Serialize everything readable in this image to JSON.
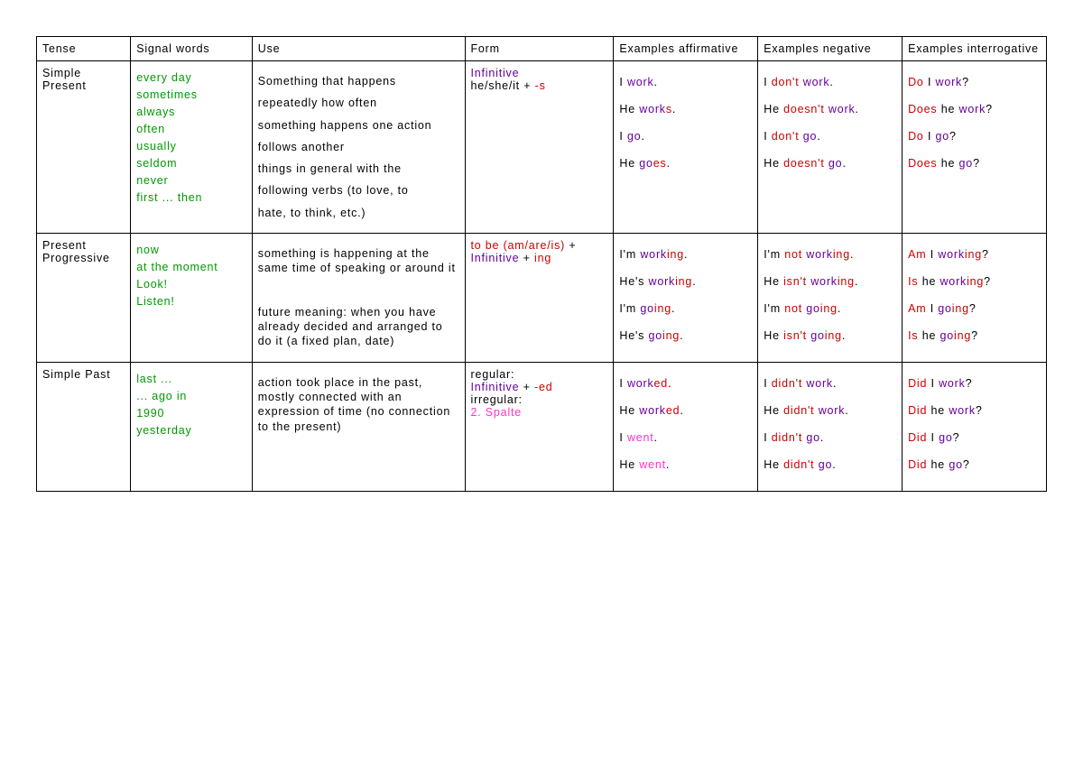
{
  "headers": {
    "tense": "Tense",
    "signal": "Signal words",
    "use": "Use",
    "form": "Form",
    "ex_aff": "Examples affirmative",
    "ex_neg": "Examples negative",
    "ex_int": "Examples interrogative"
  },
  "rows": [
    {
      "tense": "Simple Present",
      "signals": [
        "every day",
        "sometimes",
        "always",
        "often",
        "usually",
        "seldom",
        "never",
        "first ... then"
      ],
      "use_lines": [
        "Something that happens",
        "repeatedly how often",
        "something happens one action",
        "follows another",
        "things in general with the",
        "following verbs (to love, to",
        "hate, to think, etc.)"
      ],
      "form_segments": [
        {
          "text": "Infinitive",
          "cls": "purple"
        },
        {
          "text": "",
          "cls": ""
        },
        {
          "text": "he/she/it + ",
          "cls": ""
        },
        {
          "text": "-s",
          "cls": "red",
          "inline_after_prev": true
        }
      ],
      "ex_aff": [
        [
          {
            "t": "I ",
            "c": ""
          },
          {
            "t": "work",
            "c": "purple"
          },
          {
            "t": ".",
            "c": ""
          }
        ],
        [
          {
            "t": "He ",
            "c": ""
          },
          {
            "t": "work",
            "c": "purple"
          },
          {
            "t": "s",
            "c": "red"
          },
          {
            "t": ".",
            "c": ""
          }
        ],
        [
          {
            "t": "I ",
            "c": ""
          },
          {
            "t": "go",
            "c": "purple"
          },
          {
            "t": ".",
            "c": ""
          }
        ],
        [
          {
            "t": "He ",
            "c": ""
          },
          {
            "t": "go",
            "c": "purple"
          },
          {
            "t": "es",
            "c": "red"
          },
          {
            "t": ".",
            "c": ""
          }
        ]
      ],
      "ex_neg": [
        [
          {
            "t": "I ",
            "c": ""
          },
          {
            "t": "don't",
            "c": "red"
          },
          {
            "t": " ",
            "c": ""
          },
          {
            "t": "work",
            "c": "purple"
          },
          {
            "t": ".",
            "c": ""
          }
        ],
        [
          {
            "t": "He ",
            "c": ""
          },
          {
            "t": "doesn't",
            "c": "red"
          },
          {
            "t": " ",
            "c": ""
          },
          {
            "t": "work",
            "c": "purple"
          },
          {
            "t": ".",
            "c": ""
          }
        ],
        [
          {
            "t": "I ",
            "c": ""
          },
          {
            "t": "don't",
            "c": "red"
          },
          {
            "t": " ",
            "c": ""
          },
          {
            "t": "go",
            "c": "purple"
          },
          {
            "t": ".",
            "c": ""
          }
        ],
        [
          {
            "t": "He ",
            "c": ""
          },
          {
            "t": "doesn't",
            "c": "red"
          },
          {
            "t": " ",
            "c": ""
          },
          {
            "t": "go",
            "c": "purple"
          },
          {
            "t": ".",
            "c": ""
          }
        ]
      ],
      "ex_int": [
        [
          {
            "t": "Do",
            "c": "red"
          },
          {
            "t": " I ",
            "c": ""
          },
          {
            "t": "work",
            "c": "purple"
          },
          {
            "t": "?",
            "c": ""
          }
        ],
        [
          {
            "t": "Does",
            "c": "red"
          },
          {
            "t": " he ",
            "c": ""
          },
          {
            "t": "work",
            "c": "purple"
          },
          {
            "t": "?",
            "c": ""
          }
        ],
        [
          {
            "t": "Do",
            "c": "red"
          },
          {
            "t": " I ",
            "c": ""
          },
          {
            "t": "go",
            "c": "purple"
          },
          {
            "t": "?",
            "c": ""
          }
        ],
        [
          {
            "t": "Does",
            "c": "red"
          },
          {
            "t": " he ",
            "c": ""
          },
          {
            "t": "go",
            "c": "purple"
          },
          {
            "t": "?",
            "c": ""
          }
        ]
      ]
    },
    {
      "tense": "Present Progressive",
      "signals": [
        "now",
        "at the moment",
        "Look!",
        "Listen!"
      ],
      "use_lines": [
        "something is happening at the same time of speaking or around it",
        "",
        "future meaning: when you have already decided and arranged to do it (a fixed plan, date)"
      ],
      "form_segments": [
        {
          "text": "to be (am/are/is)",
          "cls": "red"
        },
        {
          "text": " + ",
          "cls": "",
          "inline_after_prev": true
        },
        {
          "text": "Infinitive",
          "cls": "purple"
        },
        {
          "text": " + ",
          "cls": "",
          "inline_after_prev": true
        },
        {
          "text": "ing",
          "cls": "red",
          "inline_after_prev": true
        }
      ],
      "ex_aff": [
        [
          {
            "t": "I'm ",
            "c": ""
          },
          {
            "t": "work",
            "c": "purple"
          },
          {
            "t": "ing",
            "c": "red"
          },
          {
            "t": ".",
            "c": ""
          }
        ],
        [
          {
            "t": "He's ",
            "c": ""
          },
          {
            "t": "work",
            "c": "purple"
          },
          {
            "t": "ing",
            "c": "red"
          },
          {
            "t": ".",
            "c": ""
          }
        ],
        [
          {
            "t": "I'm ",
            "c": ""
          },
          {
            "t": "go",
            "c": "purple"
          },
          {
            "t": "ing",
            "c": "red"
          },
          {
            "t": ".",
            "c": ""
          }
        ],
        [
          {
            "t": "He's ",
            "c": ""
          },
          {
            "t": "go",
            "c": "purple"
          },
          {
            "t": "ing",
            "c": "red"
          },
          {
            "t": ".",
            "c": ""
          }
        ]
      ],
      "ex_neg": [
        [
          {
            "t": "I'm ",
            "c": ""
          },
          {
            "t": "not",
            "c": "red"
          },
          {
            "t": " ",
            "c": ""
          },
          {
            "t": "work",
            "c": "purple"
          },
          {
            "t": "ing",
            "c": "red"
          },
          {
            "t": ".",
            "c": ""
          }
        ],
        [
          {
            "t": "He ",
            "c": ""
          },
          {
            "t": "isn't",
            "c": "red"
          },
          {
            "t": " ",
            "c": ""
          },
          {
            "t": "work",
            "c": "purple"
          },
          {
            "t": "ing",
            "c": "red"
          },
          {
            "t": ".",
            "c": ""
          }
        ],
        [
          {
            "t": "I'm ",
            "c": ""
          },
          {
            "t": "not",
            "c": "red"
          },
          {
            "t": " ",
            "c": ""
          },
          {
            "t": "go",
            "c": "purple"
          },
          {
            "t": "ing",
            "c": "red"
          },
          {
            "t": ".",
            "c": ""
          }
        ],
        [
          {
            "t": "He ",
            "c": ""
          },
          {
            "t": "isn't",
            "c": "red"
          },
          {
            "t": " ",
            "c": ""
          },
          {
            "t": "go",
            "c": "purple"
          },
          {
            "t": "ing",
            "c": "red"
          },
          {
            "t": ".",
            "c": ""
          }
        ]
      ],
      "ex_int": [
        [
          {
            "t": "Am",
            "c": "red"
          },
          {
            "t": " I ",
            "c": ""
          },
          {
            "t": "work",
            "c": "purple"
          },
          {
            "t": "ing",
            "c": "red"
          },
          {
            "t": "?",
            "c": ""
          }
        ],
        [
          {
            "t": "Is",
            "c": "red"
          },
          {
            "t": " he ",
            "c": ""
          },
          {
            "t": "work",
            "c": "purple"
          },
          {
            "t": "ing",
            "c": "red"
          },
          {
            "t": "?",
            "c": ""
          }
        ],
        [
          {
            "t": "Am",
            "c": "red"
          },
          {
            "t": " I ",
            "c": ""
          },
          {
            "t": "go",
            "c": "purple"
          },
          {
            "t": "ing",
            "c": "red"
          },
          {
            "t": "?",
            "c": ""
          }
        ],
        [
          {
            "t": "Is",
            "c": "red"
          },
          {
            "t": " he ",
            "c": ""
          },
          {
            "t": "go",
            "c": "purple"
          },
          {
            "t": "ing",
            "c": "red"
          },
          {
            "t": "?",
            "c": ""
          }
        ]
      ]
    },
    {
      "tense": "Simple Past",
      "signals": [
        "last ...",
        "... ago in",
        "1990",
        "yesterday"
      ],
      "use_lines": [
        "action took place in the past, mostly connected with an expression of time (no connection to the present)"
      ],
      "form_segments": [
        {
          "text": "regular:",
          "cls": ""
        },
        {
          "text": "Infinitive",
          "cls": "purple"
        },
        {
          "text": " + ",
          "cls": "",
          "inline_after_prev": true
        },
        {
          "text": "-ed",
          "cls": "red",
          "inline_after_prev": true
        },
        {
          "text": "",
          "cls": ""
        },
        {
          "text": "irregular:",
          "cls": ""
        },
        {
          "text": "2. Spalte",
          "cls": "pink"
        }
      ],
      "ex_aff": [
        [
          {
            "t": "I ",
            "c": ""
          },
          {
            "t": "work",
            "c": "purple"
          },
          {
            "t": "ed",
            "c": "red"
          },
          {
            "t": ".",
            "c": ""
          }
        ],
        [
          {
            "t": "He ",
            "c": ""
          },
          {
            "t": "work",
            "c": "purple"
          },
          {
            "t": "ed",
            "c": "red"
          },
          {
            "t": ".",
            "c": ""
          }
        ],
        [
          {
            "t": "I ",
            "c": ""
          },
          {
            "t": "went",
            "c": "pink"
          },
          {
            "t": ".",
            "c": ""
          }
        ],
        [
          {
            "t": "He ",
            "c": ""
          },
          {
            "t": "went",
            "c": "pink"
          },
          {
            "t": ".",
            "c": ""
          }
        ]
      ],
      "ex_neg": [
        [
          {
            "t": "I ",
            "c": ""
          },
          {
            "t": "didn't",
            "c": "red"
          },
          {
            "t": " ",
            "c": ""
          },
          {
            "t": "work",
            "c": "purple"
          },
          {
            "t": ".",
            "c": ""
          }
        ],
        [
          {
            "t": "He ",
            "c": ""
          },
          {
            "t": "didn't",
            "c": "red"
          },
          {
            "t": " ",
            "c": ""
          },
          {
            "t": "work",
            "c": "purple"
          },
          {
            "t": ".",
            "c": ""
          }
        ],
        [
          {
            "t": "I ",
            "c": ""
          },
          {
            "t": "didn't",
            "c": "red"
          },
          {
            "t": " ",
            "c": ""
          },
          {
            "t": "go",
            "c": "purple"
          },
          {
            "t": ".",
            "c": ""
          }
        ],
        [
          {
            "t": "He ",
            "c": ""
          },
          {
            "t": "didn't",
            "c": "red"
          },
          {
            "t": " ",
            "c": ""
          },
          {
            "t": "go",
            "c": "purple"
          },
          {
            "t": ".",
            "c": ""
          }
        ]
      ],
      "ex_int": [
        [
          {
            "t": "Did",
            "c": "red"
          },
          {
            "t": " I ",
            "c": ""
          },
          {
            "t": "work",
            "c": "purple"
          },
          {
            "t": "?",
            "c": ""
          }
        ],
        [
          {
            "t": "Did",
            "c": "red"
          },
          {
            "t": " he ",
            "c": ""
          },
          {
            "t": "work",
            "c": "purple"
          },
          {
            "t": "?",
            "c": ""
          }
        ],
        [
          {
            "t": "Did",
            "c": "red"
          },
          {
            "t": " I ",
            "c": ""
          },
          {
            "t": "go",
            "c": "purple"
          },
          {
            "t": "?",
            "c": ""
          }
        ],
        [
          {
            "t": "Did",
            "c": "red"
          },
          {
            "t": " he ",
            "c": ""
          },
          {
            "t": "go",
            "c": "purple"
          },
          {
            "t": "?",
            "c": ""
          }
        ]
      ]
    }
  ]
}
